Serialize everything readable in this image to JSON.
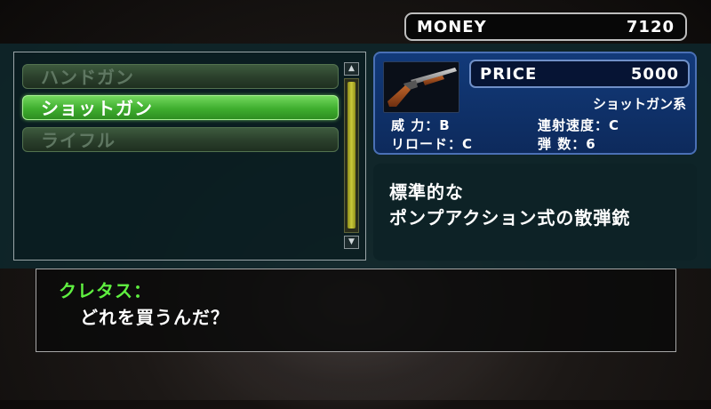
{
  "money": {
    "label": "MONEY",
    "value": "7120"
  },
  "weapon_list": {
    "items": [
      {
        "label": "ハンドガン",
        "state": "disabled"
      },
      {
        "label": "ショットガン",
        "state": "selected"
      },
      {
        "label": "ライフル",
        "state": "disabled"
      }
    ],
    "scroll_up_icon": "▲",
    "scroll_down_icon": "▼"
  },
  "detail": {
    "image_icon": "shotgun-icon",
    "price_label": "PRICE",
    "price_value": "5000",
    "category": "ショットガン系",
    "stats": {
      "power": "威 力：B",
      "fire_rate": "連射速度：C",
      "reload": "リロード：C",
      "ammo": "弾 数：6"
    }
  },
  "description": {
    "line1": "標準的な",
    "line2": "ポンプアクション式の散弾銃"
  },
  "dialog": {
    "speaker": "クレタス：",
    "text": "どれを買うんだ？"
  },
  "colors": {
    "selected_green": "#3fae2e",
    "speaker_green": "#5ff040",
    "detail_blue": "#123a7a",
    "panel_teal": "#0e282c"
  }
}
